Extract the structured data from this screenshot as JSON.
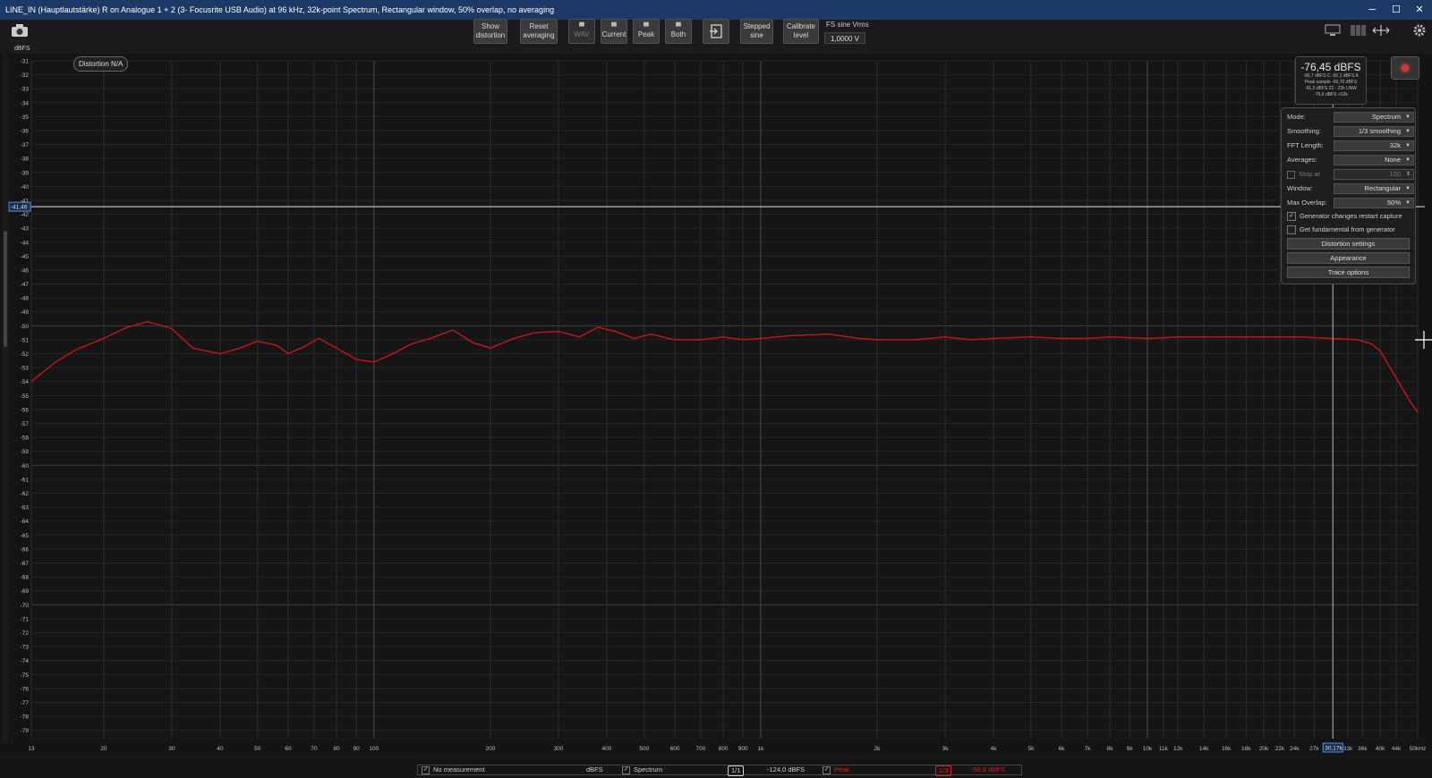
{
  "window": {
    "title": "LINE_IN (Hauptlautstärke) R on Analogue 1 + 2 (3- Focusrite USB Audio) at 96 kHz, 32k-point Spectrum, Rectangular window, 50% overlap, no averaging",
    "minimize": "─",
    "maximize": "☐",
    "close": "✕"
  },
  "toolbar": {
    "buttons": [
      {
        "line1": "Show",
        "line2": "distortion",
        "icon": ""
      },
      {
        "line1": "Reset",
        "line2": "averaging",
        "icon": ""
      },
      {
        "line1": "WAV",
        "line2": "",
        "icon": "save-icon"
      },
      {
        "line1": "Current",
        "line2": "",
        "icon": "save-icon"
      },
      {
        "line1": "Peak",
        "line2": "",
        "icon": "save-icon"
      },
      {
        "line1": "Both",
        "line2": "",
        "icon": "save-icon"
      },
      {
        "line1": "",
        "line2": "",
        "icon": "import-icon"
      },
      {
        "line1": "Stepped",
        "line2": "sine",
        "icon": ""
      },
      {
        "line1": "Calibrate",
        "line2": "level",
        "icon": ""
      }
    ],
    "fs_label": "FS sine Vrms",
    "fs_value": "1,0000 V"
  },
  "plot": {
    "unit": "dBFS",
    "cursor_value": "-41,46",
    "distortion_badge": "Distortion N/A",
    "freq_cursor_label": "30,17k"
  },
  "readout": {
    "level": "-76,45 dBFS",
    "line1": "-80,7 dBFS C  -92,1 dBFS A",
    "line2": "Peak sample -65,70 dBFS",
    "line3": "-91,0 dBFS 22 - 22k UNW",
    "line4": "-76,6 dBFS >22k"
  },
  "controls": {
    "mode_label": "Mode:",
    "mode_value": "Spectrum",
    "smoothing_label": "Smoothing:",
    "smoothing_value": "1/3 smoothing",
    "fft_label": "FFT Length:",
    "fft_value": "32k",
    "averages_label": "Averages:",
    "averages_value": "None",
    "stop_label": "Stop at",
    "stop_value": "100",
    "window_label": "Window:",
    "window_value": "Rectangular",
    "overlap_label": "Max Overlap:",
    "overlap_value": "50%",
    "gen_restart": "Generator changes restart capture",
    "get_fundamental": "Get fundamental from generator",
    "distortion_settings": "Distortion settings",
    "appearance": "Appearance",
    "trace_options": "Trace options"
  },
  "footer": {
    "no_measurement": "No measurement",
    "unit": "dBFS",
    "spectrum": "Spectrum",
    "smoothing_badge": "1/1",
    "spectrum_level": "-124,0 dBFS",
    "peak": "Peak",
    "peak_smoothing_badge": "1/3",
    "peak_level": "-50,8 dBFS"
  },
  "chart_data": {
    "type": "line",
    "x_scale": "log",
    "xlim": [
      13,
      50000
    ],
    "ylim": [
      -79.6,
      -31
    ],
    "ylabel": "dBFS",
    "y_ticks": [
      -31,
      -32,
      -33,
      -34,
      -35,
      -36,
      -37,
      -38,
      -39,
      -40,
      -41,
      -42,
      -43,
      -44,
      -45,
      -46,
      -47,
      -48,
      -49,
      -50,
      -51,
      -52,
      -53,
      -54,
      -55,
      -56,
      -57,
      -58,
      -59,
      -60,
      -61,
      -62,
      -63,
      -64,
      -65,
      -66,
      -67,
      -68,
      -69,
      -70,
      -71,
      -72,
      -73,
      -74,
      -75,
      -76,
      -77,
      -78,
      -79
    ],
    "x_ticks": [
      {
        "v": 13,
        "l": "13"
      },
      {
        "v": 20,
        "l": "20"
      },
      {
        "v": 30,
        "l": "30"
      },
      {
        "v": 40,
        "l": "40"
      },
      {
        "v": 50,
        "l": "50"
      },
      {
        "v": 60,
        "l": "60"
      },
      {
        "v": 70,
        "l": "70"
      },
      {
        "v": 80,
        "l": "80"
      },
      {
        "v": 90,
        "l": "90"
      },
      {
        "v": 100,
        "l": "100"
      },
      {
        "v": 200,
        "l": "200"
      },
      {
        "v": 300,
        "l": "300"
      },
      {
        "v": 400,
        "l": "400"
      },
      {
        "v": 500,
        "l": "500"
      },
      {
        "v": 600,
        "l": "600"
      },
      {
        "v": 700,
        "l": "700"
      },
      {
        "v": 800,
        "l": "800"
      },
      {
        "v": 900,
        "l": "900"
      },
      {
        "v": 1000,
        "l": "1k"
      },
      {
        "v": 2000,
        "l": "2k"
      },
      {
        "v": 3000,
        "l": "3k"
      },
      {
        "v": 4000,
        "l": "4k"
      },
      {
        "v": 5000,
        "l": "5k"
      },
      {
        "v": 6000,
        "l": "6k"
      },
      {
        "v": 7000,
        "l": "7k"
      },
      {
        "v": 8000,
        "l": "8k"
      },
      {
        "v": 9000,
        "l": "9k"
      },
      {
        "v": 10000,
        "l": "10k"
      },
      {
        "v": 11000,
        "l": "11k"
      },
      {
        "v": 12000,
        "l": "12k"
      },
      {
        "v": 14000,
        "l": "14k"
      },
      {
        "v": 16000,
        "l": "16k"
      },
      {
        "v": 18000,
        "l": "18k"
      },
      {
        "v": 20000,
        "l": "20k"
      },
      {
        "v": 22000,
        "l": "22k"
      },
      {
        "v": 24000,
        "l": "24k"
      },
      {
        "v": 27000,
        "l": "27k"
      },
      {
        "v": 33000,
        "l": "33k"
      },
      {
        "v": 36000,
        "l": "36k"
      },
      {
        "v": 40000,
        "l": "40k"
      },
      {
        "v": 44000,
        "l": "44k"
      },
      {
        "v": 50000,
        "l": "50kHz"
      }
    ],
    "series": [
      {
        "name": "Peak",
        "color": "#c01818",
        "x": [
          13,
          15,
          17,
          20,
          23,
          26,
          30,
          34,
          40,
          45,
          50,
          56,
          60,
          66,
          72,
          80,
          90,
          100,
          110,
          125,
          140,
          160,
          180,
          200,
          230,
          260,
          300,
          340,
          380,
          420,
          470,
          520,
          600,
          700,
          800,
          900,
          1000,
          1200,
          1500,
          1800,
          2000,
          2500,
          3000,
          3500,
          4000,
          5000,
          6000,
          7000,
          8000,
          10000,
          12000,
          15000,
          20000,
          25000,
          30000,
          35000,
          38000,
          40000,
          42000,
          45000,
          48000,
          50000
        ],
        "y": [
          -54,
          -52.6,
          -51.7,
          -50.9,
          -50.1,
          -49.7,
          -50.2,
          -51.6,
          -52,
          -51.6,
          -51.1,
          -51.4,
          -52,
          -51.5,
          -50.9,
          -51.6,
          -52.4,
          -52.6,
          -52.1,
          -51.3,
          -50.9,
          -50.3,
          -51.2,
          -51.6,
          -50.9,
          -50.5,
          -50.4,
          -50.8,
          -50.1,
          -50.4,
          -50.9,
          -50.6,
          -51,
          -51,
          -50.8,
          -51,
          -50.9,
          -50.7,
          -50.6,
          -50.9,
          -51,
          -51,
          -50.8,
          -51,
          -50.9,
          -50.8,
          -50.9,
          -50.9,
          -50.8,
          -50.9,
          -50.8,
          -50.8,
          -50.8,
          -50.8,
          -50.9,
          -51,
          -51.3,
          -51.8,
          -52.8,
          -54.2,
          -55.5,
          -56.2
        ]
      }
    ]
  }
}
